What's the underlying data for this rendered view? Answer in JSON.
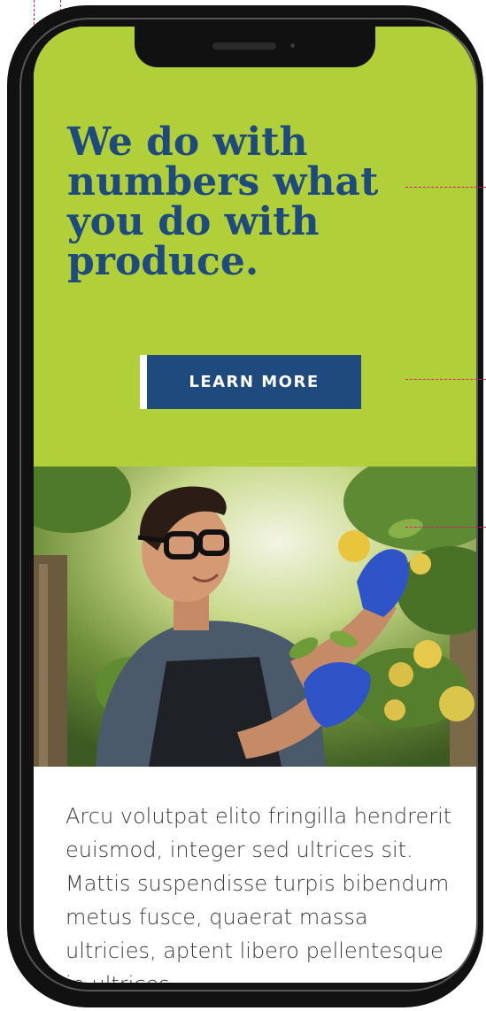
{
  "hero": {
    "headline": "We do with numbers what you do with produce.",
    "cta_label": "LEARN MORE"
  },
  "photo": {
    "description_icon": "farmer-picking-fruit-image"
  },
  "content": {
    "body": "Arcu volutpat elito fringilla hendrerit euismod, integer sed ultrices sit. Mattis suspendisse turpis bibendum metus fusce, quaerat massa ultricies, aptent libero pellentesque in ultrices"
  },
  "colors": {
    "hero_background": "#b0cf39",
    "brand_blue": "#1e4a7e",
    "guide_magenta": "#d81b60"
  }
}
